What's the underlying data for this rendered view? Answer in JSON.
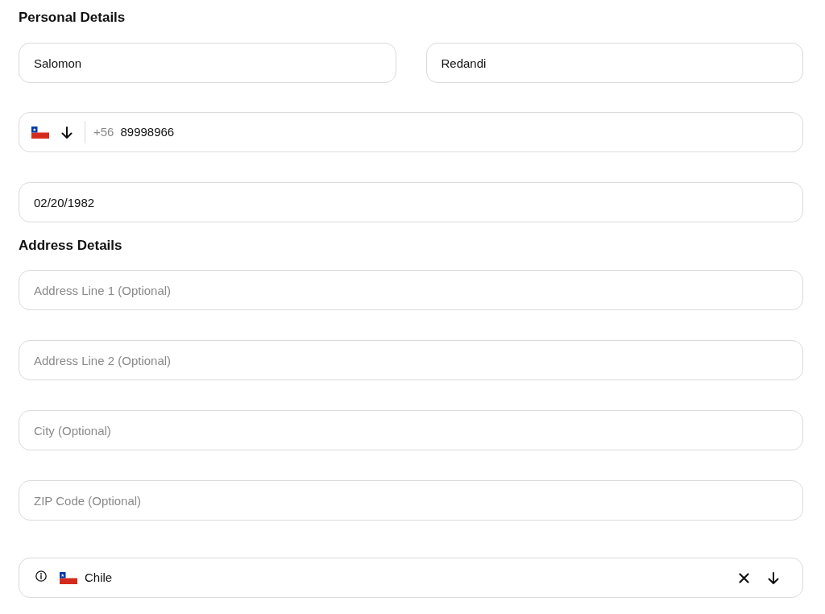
{
  "personal_details": {
    "title": "Personal Details",
    "name_fields": [
      {
        "value": "Salomon"
      },
      {
        "value": "Redandi"
      }
    ],
    "phone": {
      "dial_code": "+56",
      "number": "89998966"
    },
    "date_field": {
      "value": "02/20/1982"
    }
  },
  "address_details": {
    "title": "Address Details",
    "fields": [
      {
        "placeholder": "Address Line 1 (Optional)"
      },
      {
        "placeholder": "Address Line 2 (Optional)"
      },
      {
        "placeholder": "City (Optional)"
      },
      {
        "placeholder": "ZIP Code (Optional)"
      }
    ],
    "country_select": {
      "value": "Chile"
    }
  }
}
